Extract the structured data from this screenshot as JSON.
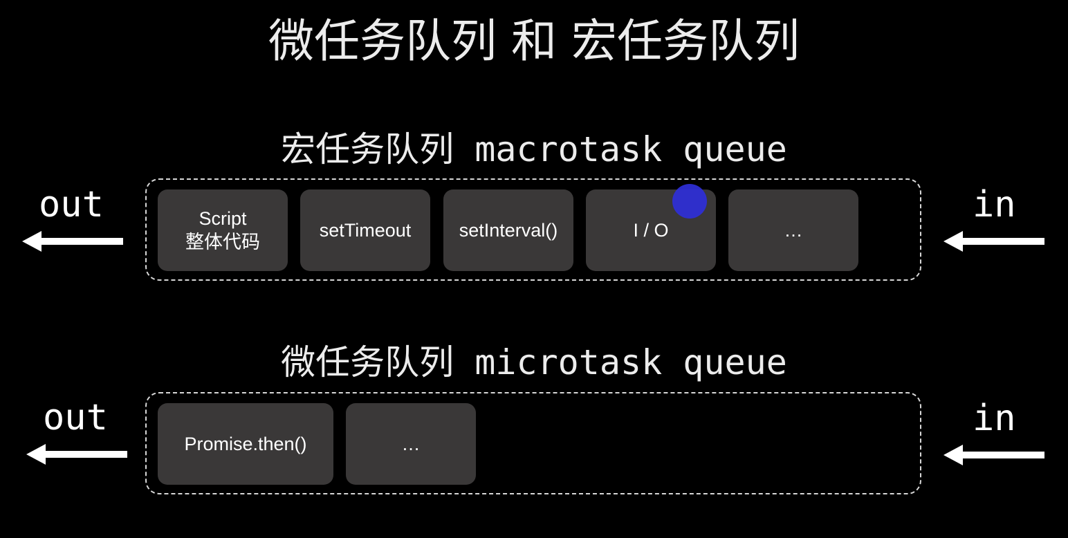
{
  "title": "微任务队列 和 宏任务队列",
  "colors": {
    "background": "#000000",
    "task_fill": "#3a3838",
    "dashed_border": "#d8d8d8",
    "text": "#ffffff",
    "cursor_dot": "#2f2fd8"
  },
  "macro": {
    "title": "宏任务队列 macrotask queue",
    "out_label": "out",
    "in_label": "in",
    "tasks": [
      {
        "label": "Script\n整体代码"
      },
      {
        "label": "setTimeout"
      },
      {
        "label": "setInterval()"
      },
      {
        "label": "I / O"
      },
      {
        "label": "…"
      }
    ]
  },
  "micro": {
    "title": "微任务队列 microtask queue",
    "out_label": "out",
    "in_label": "in",
    "tasks": [
      {
        "label": "Promise.then()"
      },
      {
        "label": "…"
      }
    ]
  }
}
